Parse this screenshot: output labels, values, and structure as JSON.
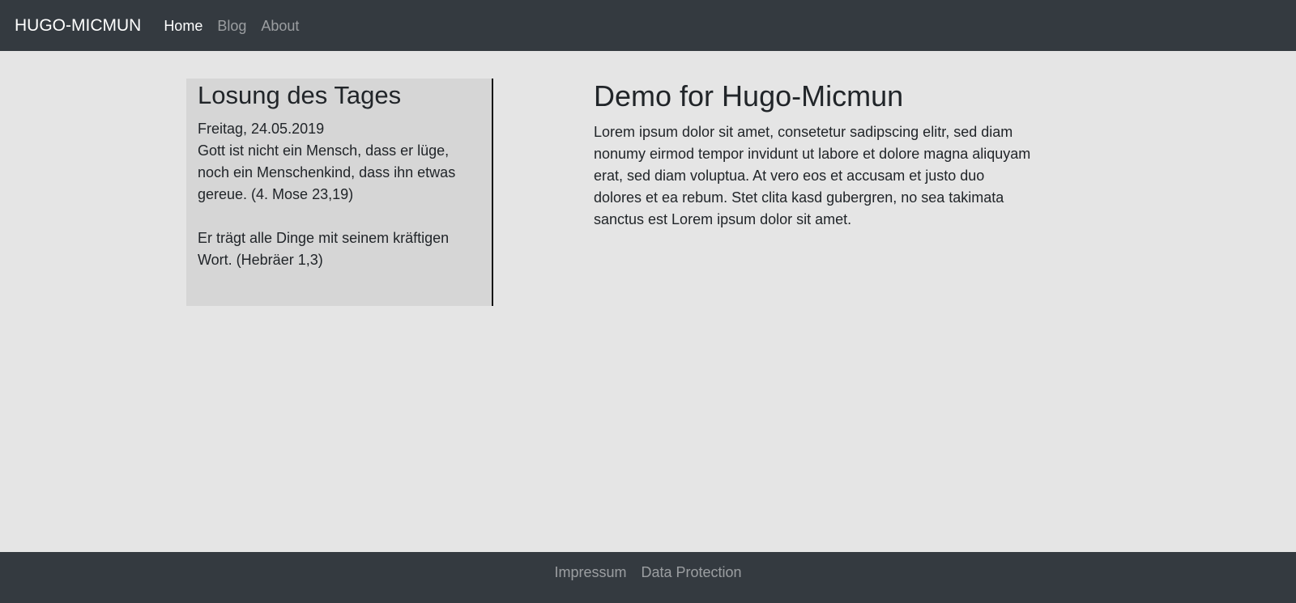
{
  "navbar": {
    "brand": "HUGO-MICMUN",
    "items": [
      {
        "label": "Home",
        "active": true
      },
      {
        "label": "Blog",
        "active": false
      },
      {
        "label": "About",
        "active": false
      }
    ]
  },
  "losung": {
    "title": "Losung des Tages",
    "date": "Freitag, 24.05.2019",
    "verse1": "Gott ist nicht ein Mensch, dass er lüge, noch ein Menschenkind, dass ihn etwas gereue. (4. Mose 23,19)",
    "verse2": "Er trägt alle Dinge mit seinem kräftigen Wort. (Hebräer 1,3)"
  },
  "main": {
    "title": "Demo for Hugo-Micmun",
    "body": "Lorem ipsum dolor sit amet, consetetur sadipscing elitr, sed diam nonumy eirmod tempor invidunt ut labore et dolore magna aliquyam erat, sed diam voluptua. At vero eos et accusam et justo duo dolores et ea rebum. Stet clita kasd gubergren, no sea takimata sanctus est Lorem ipsum dolor sit amet."
  },
  "footer": {
    "links": [
      "Impressum",
      "Data Protection"
    ]
  },
  "colors": {
    "navbar_bg": "#343a40",
    "page_bg": "#e5e5e5",
    "sidebar_bg": "#d6d6d6"
  }
}
